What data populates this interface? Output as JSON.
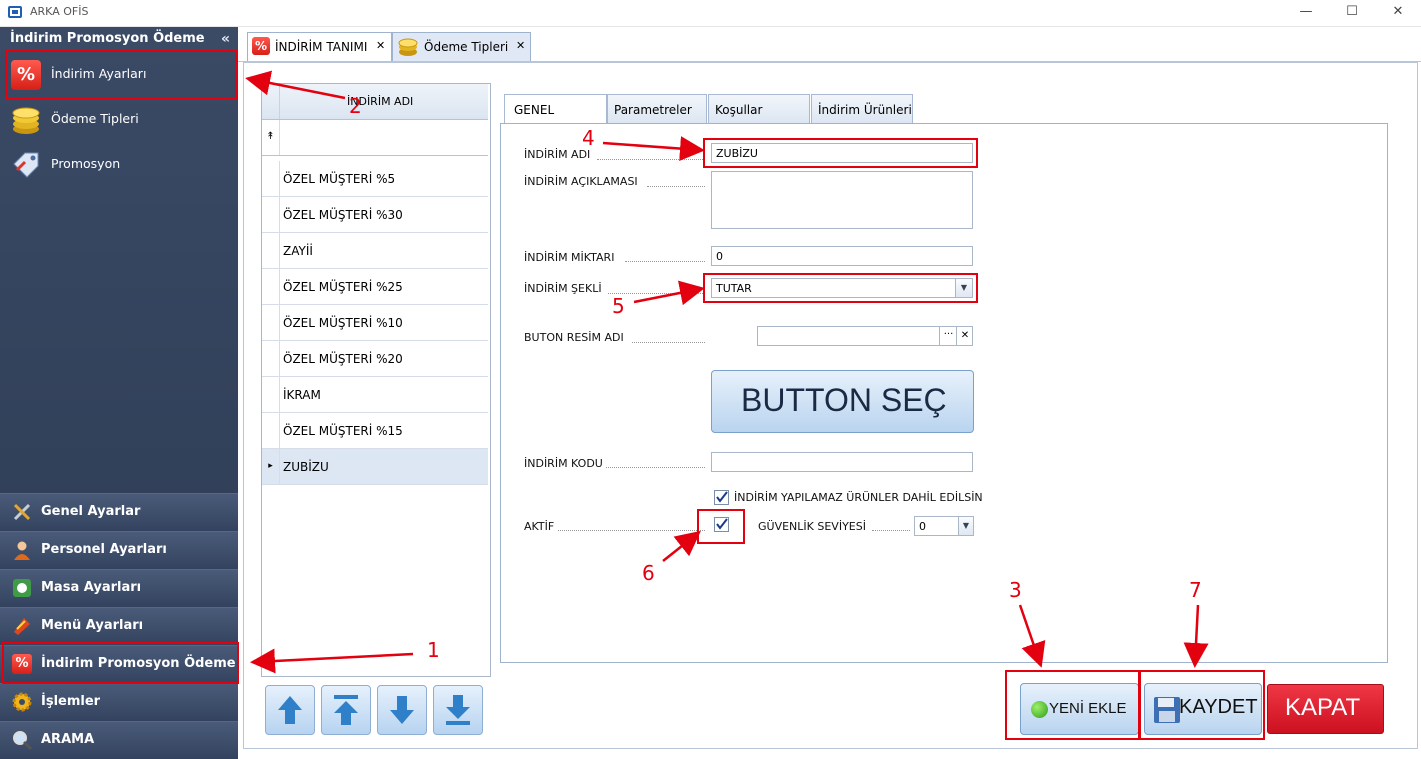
{
  "window": {
    "title": "ARKA OFİS",
    "controls": {
      "minimize": "—",
      "maximize": "☐",
      "close": "✕"
    }
  },
  "sidebar": {
    "header": "İndirim Promosyon Ödeme",
    "collapse_icon": "«",
    "items": [
      {
        "label": "İndirim Ayarları",
        "icon": "percent-icon"
      },
      {
        "label": "Ödeme Tipleri",
        "icon": "coins-icon"
      },
      {
        "label": "Promosyon",
        "icon": "tag-icon"
      }
    ],
    "groups": [
      {
        "label": "Genel Ayarlar",
        "icon": "tools-icon"
      },
      {
        "label": "Personel Ayarları",
        "icon": "person-icon"
      },
      {
        "label": "Masa Ayarları",
        "icon": "table-icon"
      },
      {
        "label": "Menü Ayarları",
        "icon": "menu-icon"
      },
      {
        "label": "İndirim Promosyon Ödeme",
        "icon": "percent-icon"
      },
      {
        "label": "İşlemler",
        "icon": "gear-icon"
      },
      {
        "label": "ARAMA",
        "icon": "search-icon"
      }
    ]
  },
  "tabs": [
    {
      "label": "İNDİRİM TANIMI",
      "close": "✕",
      "active": true
    },
    {
      "label": "Ödeme Tipleri",
      "close": "✕",
      "active": false
    }
  ],
  "grid": {
    "column_header": "İNDİRİM ADI",
    "filter_glyph": "↟",
    "rows": [
      "ÖZEL MÜŞTERİ %5",
      "ÖZEL MÜŞTERİ %30",
      "ZAYİİ",
      "ÖZEL MÜŞTERİ %25",
      "ÖZEL MÜŞTERİ %10",
      "ÖZEL MÜŞTERİ %20",
      "İKRAM",
      "ÖZEL MÜŞTERİ %15",
      "ZUBİZU"
    ],
    "selected_row_index": 8,
    "current_row_glyph": "▸"
  },
  "form_tabs": [
    "GENEL",
    "Parametreler",
    "Koşullar",
    "İndirim Ürünleri"
  ],
  "form": {
    "name_label": "İNDİRİM ADI",
    "name_value": "ZUBİZU",
    "desc_label": "İNDİRİM AÇIKLAMASI",
    "desc_value": "",
    "amount_label": "İNDİRİM MİKTARI",
    "amount_value": "0",
    "type_label": "İNDİRİM ŞEKLİ",
    "type_value": "TUTAR",
    "button_image_label": "BUTON RESİM ADI",
    "button_image_value": "",
    "browse_glyph": "···",
    "clear_glyph": "✕",
    "select_button_label": "BUTTON SEÇ",
    "code_label": "İNDİRİM KODU",
    "code_value": "",
    "excluded_checkbox_label": "İNDİRİM YAPILAMAZ ÜRÜNLER DAHİL EDİLSİN",
    "excluded_checked": true,
    "active_label": "AKTİF",
    "active_checked": true,
    "security_label": "GÜVENLİK SEVİYESİ",
    "security_value": "0"
  },
  "actions": {
    "new": "YENİ EKLE",
    "save": "KAYDET",
    "close": "KAPAT"
  },
  "annotations": [
    "1",
    "2",
    "3",
    "4",
    "5",
    "6",
    "7"
  ],
  "colors": {
    "annotation_red": "#e3000f",
    "sidebar_bg": "#34435d",
    "close_button": "#e0182a",
    "selected_row": "#dde7f4"
  }
}
